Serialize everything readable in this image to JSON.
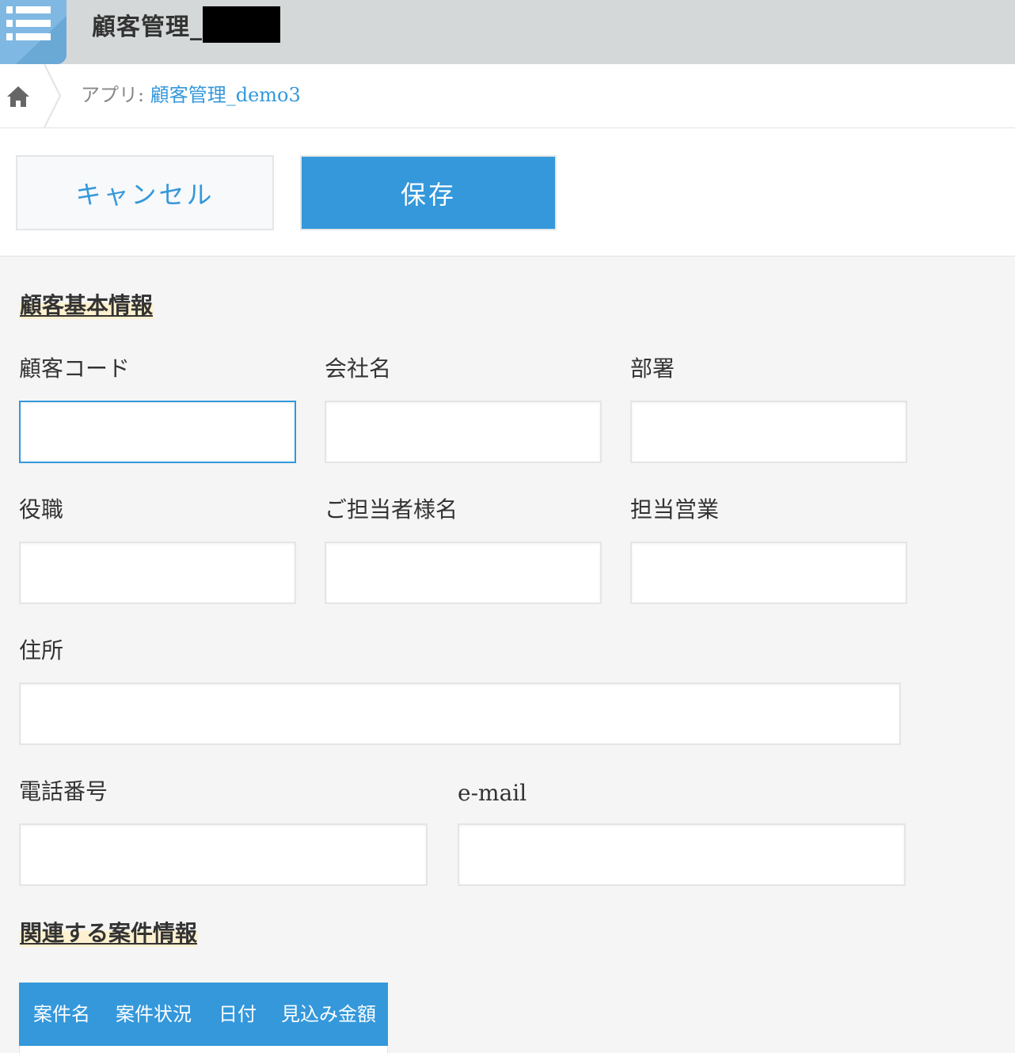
{
  "header": {
    "app_title": "顧客管理_",
    "app_icon": "list-icon"
  },
  "breadcrumb": {
    "home_icon": "home-icon",
    "label": "アプリ: ",
    "app_link": "顧客管理_demo3"
  },
  "toolbar": {
    "cancel_label": "キャンセル",
    "save_label": "保存"
  },
  "sections": {
    "basic_info": "顧客基本情報",
    "related_projects": "関連する案件情報"
  },
  "fields": {
    "customer_code": {
      "label": "顧客コード",
      "value": ""
    },
    "company_name": {
      "label": "会社名",
      "value": ""
    },
    "department": {
      "label": "部署",
      "value": ""
    },
    "position": {
      "label": "役職",
      "value": ""
    },
    "contact_name": {
      "label": "ご担当者様名",
      "value": ""
    },
    "sales_rep": {
      "label": "担当営業",
      "value": ""
    },
    "address": {
      "label": "住所",
      "value": ""
    },
    "phone": {
      "label": "電話番号",
      "value": ""
    },
    "email": {
      "label": "e-mail",
      "value": ""
    }
  },
  "related_table": {
    "columns": [
      "案件名",
      "案件状況",
      "日付",
      "見込み金額"
    ]
  },
  "colors": {
    "accent": "#3498db",
    "header_bg": "#d5d8d9",
    "form_bg": "#f5f5f5",
    "section_highlight": "#fdf1cf"
  }
}
